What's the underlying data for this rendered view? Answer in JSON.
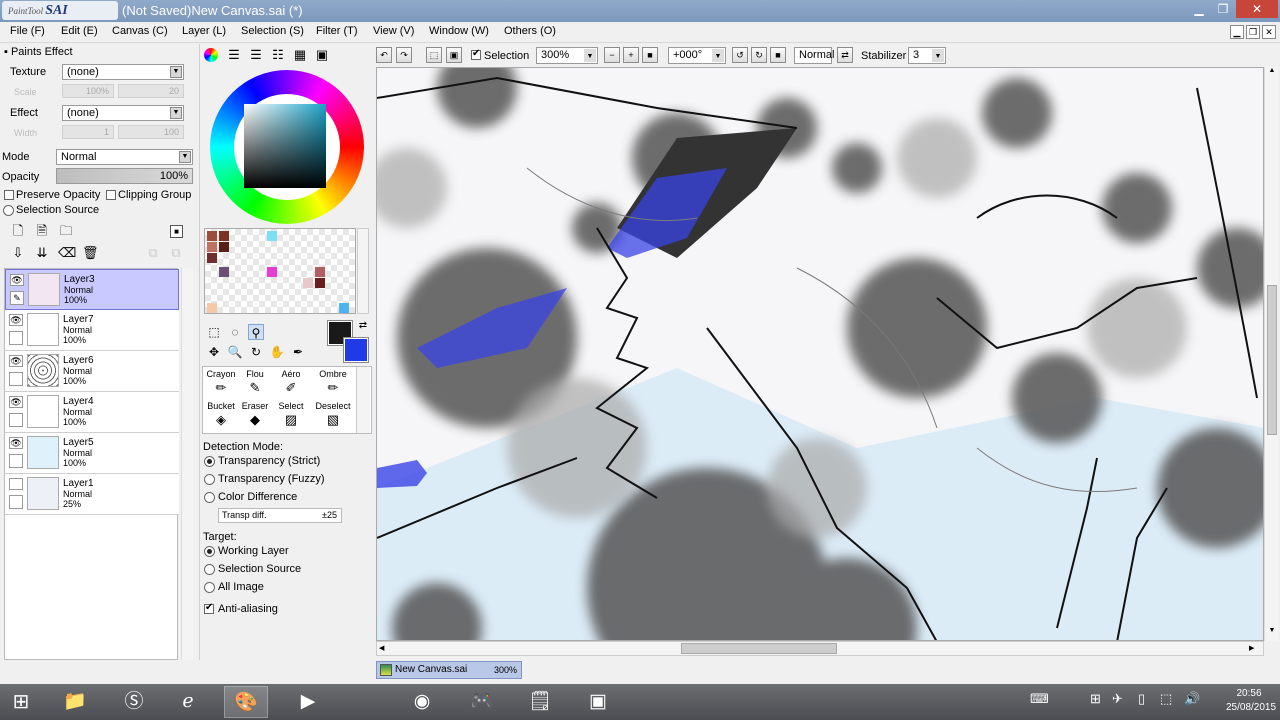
{
  "app": {
    "logo": "PaintTool SAI",
    "logo_prefix": "PaintTool",
    "logo_main": "SAI",
    "title": "(Not Saved)New Canvas.sai (*)"
  },
  "menu": [
    "File (F)",
    "Edit (E)",
    "Canvas (C)",
    "Layer (L)",
    "Selection (S)",
    "Filter (T)",
    "View (V)",
    "Window (W)",
    "Others (O)"
  ],
  "paints_effect": {
    "header": "Paints Effect",
    "texture_label": "Texture",
    "texture_value": "(none)",
    "scale_label": "Scale",
    "scale_value": "100%",
    "scale_num": "20",
    "effect_label": "Effect",
    "effect_value": "(none)",
    "width_label": "Width",
    "width_value": "1",
    "width_num": "100"
  },
  "layer_props": {
    "mode_label": "Mode",
    "mode_value": "Normal",
    "opacity_label": "Opacity",
    "opacity_value": "100%",
    "preserve_opacity": "Preserve Opacity",
    "clipping_group": "Clipping Group",
    "selection_source": "Selection Source"
  },
  "layers": [
    {
      "name": "Layer3",
      "mode": "Normal",
      "opacity": "100%",
      "visible": true,
      "active": true,
      "thumb": "#f3e6f3"
    },
    {
      "name": "Layer7",
      "mode": "Normal",
      "opacity": "100%",
      "visible": true,
      "active": false,
      "thumb": "#ffffff"
    },
    {
      "name": "Layer6",
      "mode": "Normal",
      "opacity": "100%",
      "visible": true,
      "active": false,
      "thumb": "#e8e8e8"
    },
    {
      "name": "Layer4",
      "mode": "Normal",
      "opacity": "100%",
      "visible": true,
      "active": false,
      "thumb": "#ffffff"
    },
    {
      "name": "Layer5",
      "mode": "Normal",
      "opacity": "100%",
      "visible": true,
      "active": false,
      "thumb": "#dff1fb"
    },
    {
      "name": "Layer1",
      "mode": "Normal",
      "opacity": "25%",
      "visible": false,
      "active": false,
      "thumb": "#eef0f7"
    }
  ],
  "tools": [
    {
      "label": "Crayon",
      "icon": "crayon-icon"
    },
    {
      "label": "Flou",
      "icon": "blur-icon"
    },
    {
      "label": "Aéro",
      "icon": "airbrush-icon"
    },
    {
      "label": "Ombre",
      "icon": "shadow-icon"
    },
    {
      "label": "Bucket",
      "icon": "bucket-icon"
    },
    {
      "label": "Eraser",
      "icon": "eraser-icon"
    },
    {
      "label": "Select",
      "icon": "select-icon"
    },
    {
      "label": "Deselect",
      "icon": "deselect-icon"
    }
  ],
  "colors": {
    "foreground": "#1a1a1a",
    "background": "#1f3ae6",
    "accent": "#c9c9ff"
  },
  "detection": {
    "title": "Detection Mode:",
    "options": [
      "Transparency (Strict)",
      "Transparency (Fuzzy)",
      "Color Difference"
    ],
    "selected": 0,
    "transp_label": "Transp diff.",
    "transp_value": "±25"
  },
  "target": {
    "title": "Target:",
    "options": [
      "Working Layer",
      "Selection Source",
      "All Image"
    ],
    "selected": 0,
    "antialias": "Anti-aliasing",
    "antialias_on": true
  },
  "toolbar": {
    "selection_label": "Selection",
    "selection_checked": true,
    "zoom": "300%",
    "rotation": "+000°",
    "blend": "Normal",
    "stabilizer_label": "Stabilizer",
    "stabilizer_value": "3"
  },
  "doc_tab": {
    "name": "New Canvas.sai",
    "zoom": "300%"
  },
  "taskbar": {
    "time": "20:56",
    "date": "25/08/2015",
    "apps": [
      "file-explorer-icon",
      "skype-icon",
      "internet-explorer-icon",
      "painttool-sai-icon",
      "media-player-icon",
      "vlc-icon",
      "game-icon",
      "notepad-icon",
      "app-icon"
    ]
  }
}
